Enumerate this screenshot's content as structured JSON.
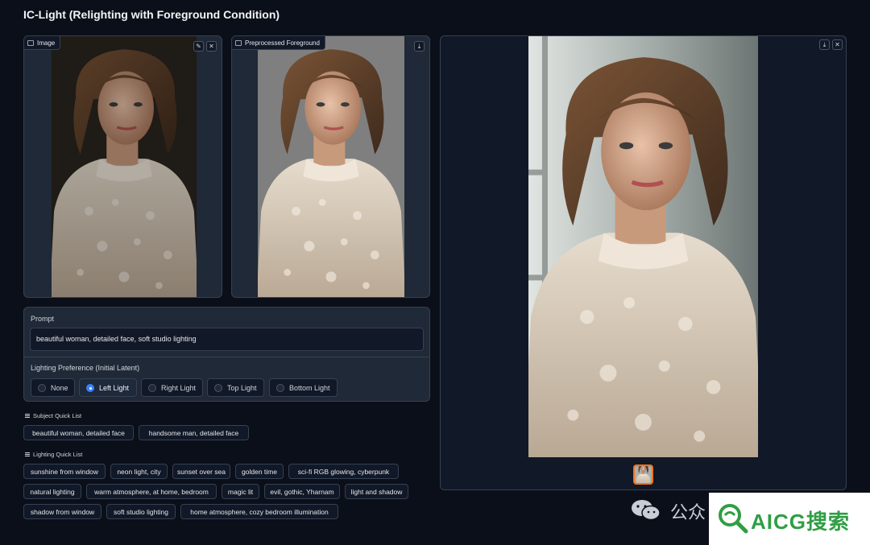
{
  "app": {
    "title": "IC-Light (Relighting with Foreground Condition)"
  },
  "input_image": {
    "label": "Image",
    "edit_icon": "pencil-icon",
    "close_icon": "close-icon"
  },
  "preprocessed": {
    "label": "Preprocessed Foreground",
    "download_icon": "download-icon"
  },
  "output_gallery": {
    "download_icon": "download-icon",
    "close_icon": "close-icon"
  },
  "prompt": {
    "label": "Prompt",
    "value": "beautiful woman, detailed face, soft studio lighting"
  },
  "lighting_pref": {
    "label": "Lighting Preference (Initial Latent)",
    "options": [
      "None",
      "Left Light",
      "Right Light",
      "Top Light",
      "Bottom Light"
    ],
    "selected": "Left Light"
  },
  "subject_list": {
    "title": "Subject Quick List",
    "items": [
      "beautiful woman, detailed face",
      "handsome man, detailed face"
    ]
  },
  "lighting_list": {
    "title": "Lighting Quick List",
    "items": [
      "sunshine from window",
      "neon light, city",
      "sunset over sea",
      "golden time",
      "sci-fi RGB glowing, cyberpunk",
      "natural lighting",
      "warm atmosphere, at home, bedroom",
      "magic lit",
      "evil, gothic, Yharnam",
      "light and shadow",
      "shadow from window",
      "soft studio lighting",
      "home atmosphere, cozy bedroom illumination"
    ]
  },
  "watermark": {
    "wechat": "公众",
    "brand": "AICG搜索"
  },
  "colors": {
    "background": "#0b0f19",
    "panel": "#1f2937",
    "accent": "#3b82f6",
    "thumb_border": "#f97316",
    "brand": "#2f9e44"
  }
}
